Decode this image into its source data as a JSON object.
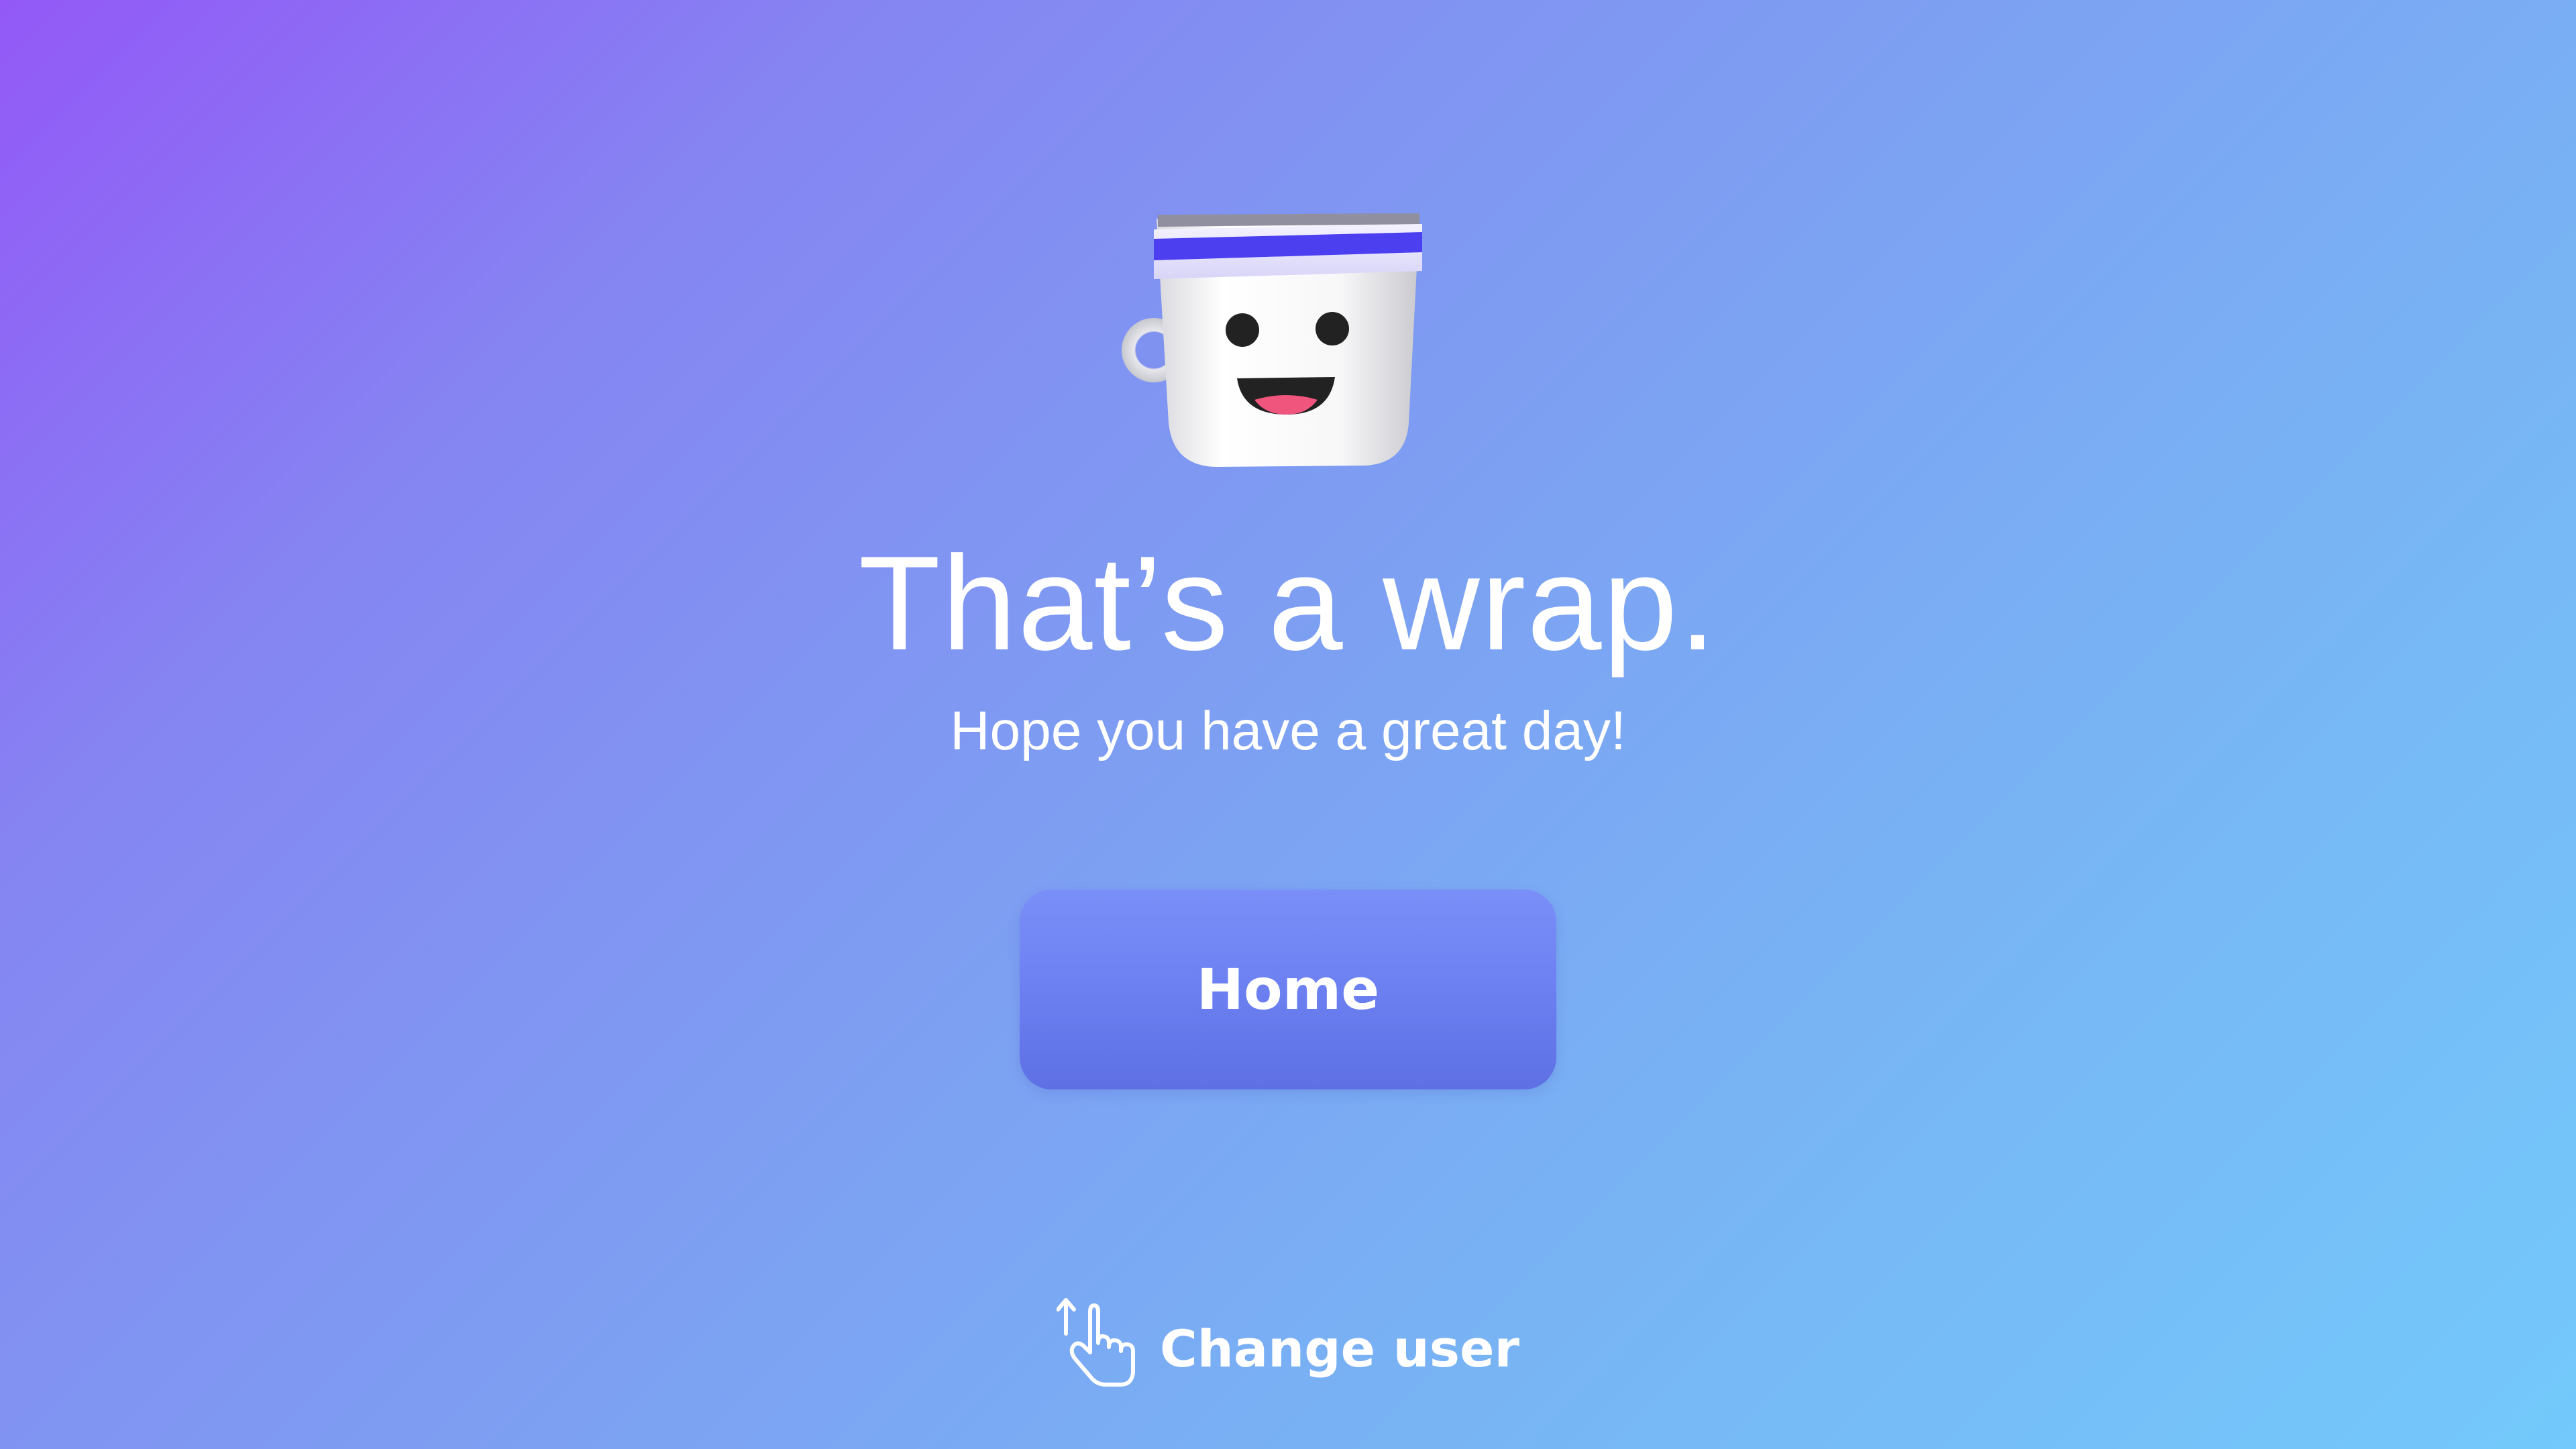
{
  "screen": {
    "title": "That’s a wrap.",
    "subtitle": "Hope you have a great day!"
  },
  "actions": {
    "home_label": "Home",
    "change_user_label": "Change user"
  },
  "icons": {
    "mascot": "coffee-cup-mascot-icon",
    "change_user": "hand-swipe-up-icon"
  },
  "colors": {
    "background_start": "#9358f7",
    "background_end": "#73c9fb",
    "button": "#6a7ef0",
    "text": "#ffffff",
    "headband_stripe": "#4b3ff0"
  }
}
